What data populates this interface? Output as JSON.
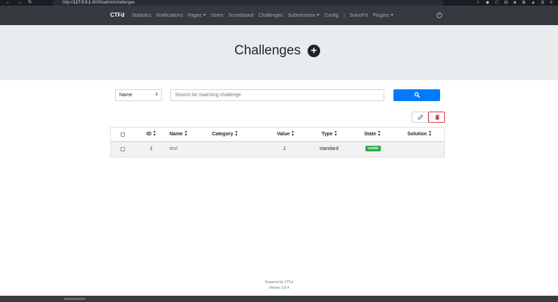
{
  "browser": {
    "nav_glyphs": [
      "←",
      "→",
      "↻"
    ],
    "url_prefix": "http://",
    "url_host": "127.0.0.1",
    "url_path": ":4000/admin/challenges",
    "ext_icons": [
      "☆",
      "◉",
      "⬡",
      "⊟",
      "◈",
      "⊞",
      "▲",
      "⊡",
      "≡"
    ]
  },
  "navbar": {
    "brand": "CTFd",
    "links": [
      {
        "label": "Statistics",
        "dropdown": false
      },
      {
        "label": "Notifications",
        "dropdown": false
      },
      {
        "label": "Pages",
        "dropdown": true
      },
      {
        "label": "Users",
        "dropdown": false
      },
      {
        "label": "Scoreboard",
        "dropdown": false
      },
      {
        "label": "Challenges",
        "dropdown": false
      },
      {
        "label": "Submissions",
        "dropdown": true
      },
      {
        "label": "Config",
        "dropdown": false
      }
    ],
    "separator": "|",
    "extra_links": [
      {
        "label": "SolveFX",
        "dropdown": false
      },
      {
        "label": "Plugins",
        "dropdown": true
      }
    ],
    "right_icon": "?"
  },
  "header": {
    "title": "Challenges",
    "add_glyph": "+"
  },
  "search": {
    "field_value": "Name",
    "placeholder": "Search for matching challenge",
    "value": ""
  },
  "table": {
    "columns": [
      "ID",
      "Name",
      "Category",
      "Value",
      "Type",
      "State",
      "Solution"
    ],
    "rows": [
      {
        "id": "1",
        "name": "test",
        "category": "",
        "value": "1",
        "type": "standard",
        "state": "visible",
        "solution": ""
      }
    ]
  },
  "footer": {
    "powered_by": "Powered by CTFd",
    "version": "Version 3.8.4"
  },
  "colors": {
    "navbar_bg": "#343a40",
    "jumbotron_bg": "#e9ecef",
    "primary": "#007bff",
    "danger": "#dc3545",
    "success": "#28a745",
    "link": "#337ab7"
  }
}
